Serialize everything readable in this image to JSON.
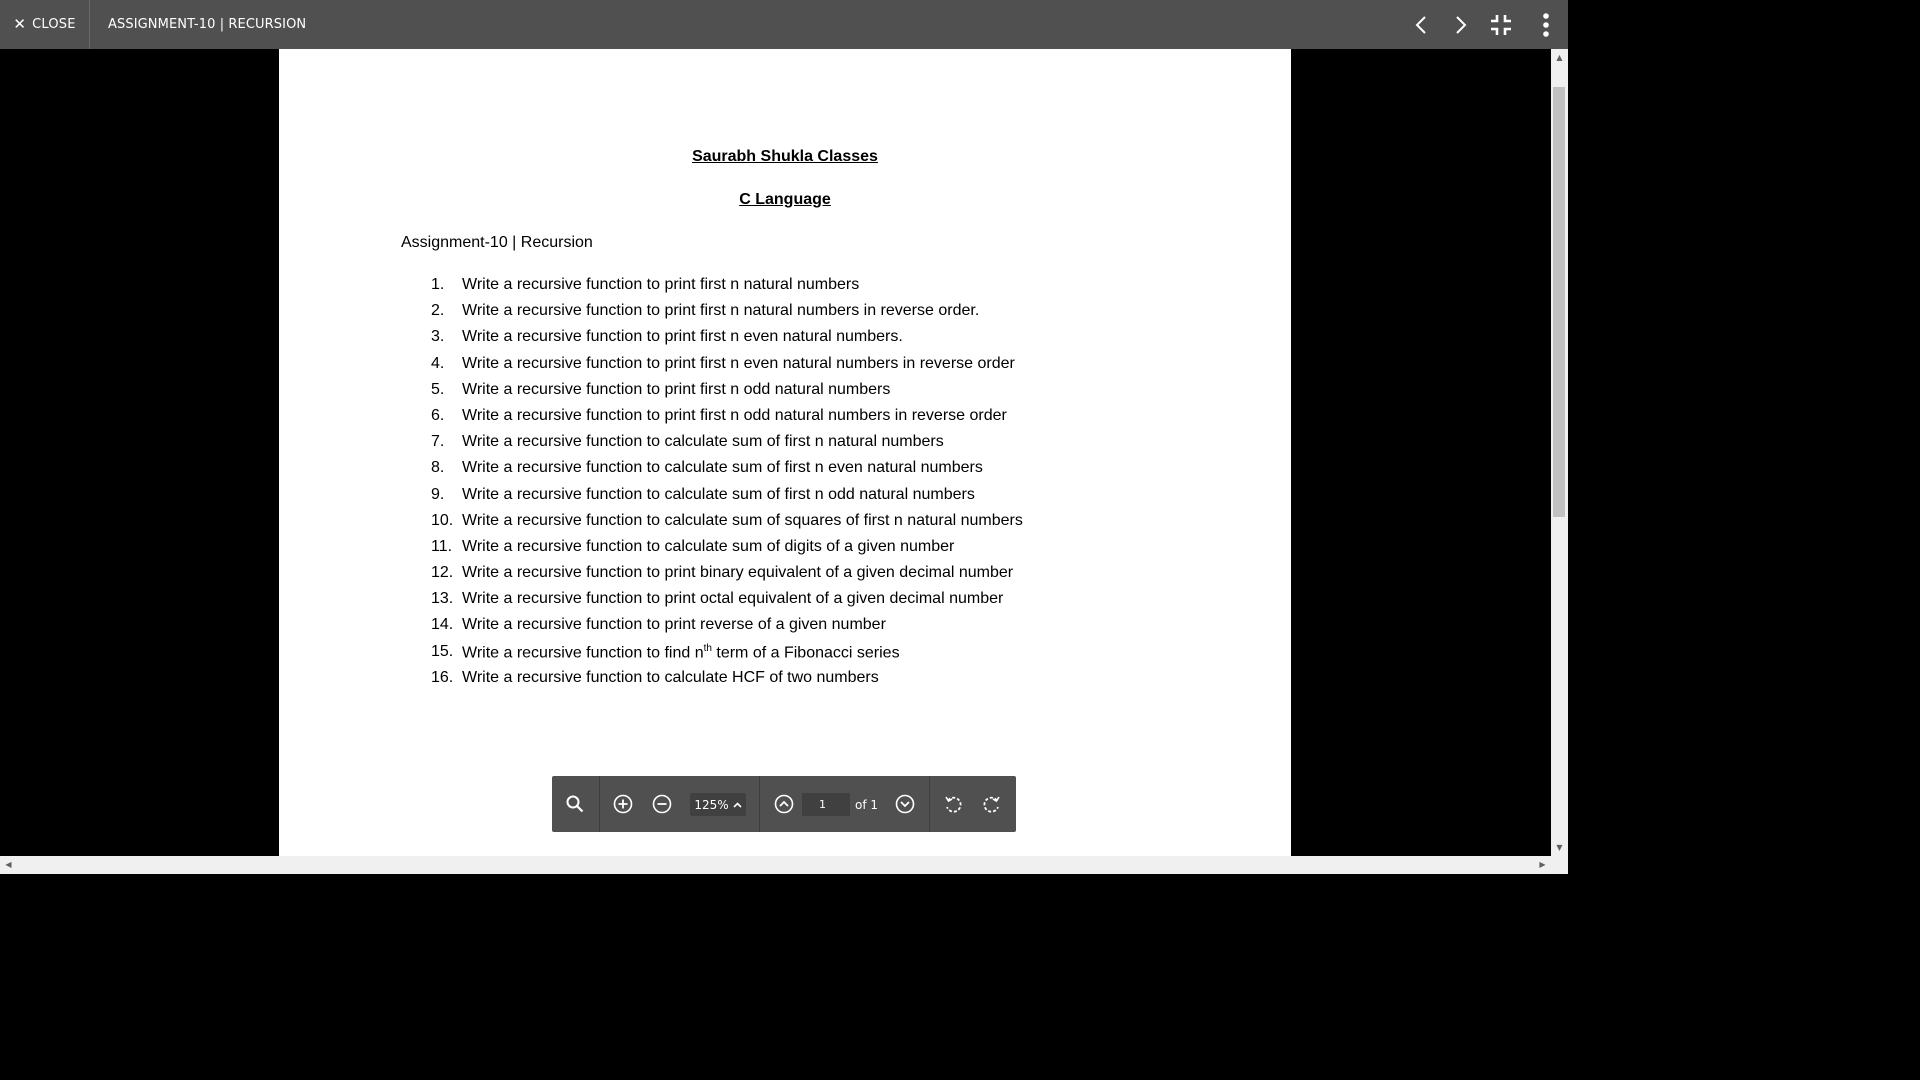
{
  "header": {
    "close_label": "CLOSE",
    "title": "ASSIGNMENT-10 | RECURSION",
    "icons": [
      "close-icon",
      "chevron-left-icon",
      "chevron-right-icon",
      "exit-fullscreen-icon",
      "more-vert-icon"
    ]
  },
  "document": {
    "heading1": "Saurabh Shukla Classes",
    "heading2": "C Language",
    "subtitle": "Assignment-10 | Recursion",
    "questions": [
      {
        "num": "1.",
        "text": "Write a recursive function to print first n natural numbers"
      },
      {
        "num": "2.",
        "text": "Write a recursive function to print first n natural numbers in reverse order."
      },
      {
        "num": "3.",
        "text": "Write a recursive function to print first n even natural numbers."
      },
      {
        "num": "4.",
        "text": "Write a recursive function to print first n even natural numbers in reverse order"
      },
      {
        "num": "5.",
        "text": "Write a recursive function to print first n odd natural numbers"
      },
      {
        "num": "6.",
        "text": "Write a recursive function to print first n odd natural numbers in reverse order"
      },
      {
        "num": "7.",
        "text": "Write a recursive function to calculate sum of first n natural numbers"
      },
      {
        "num": "8.",
        "text": "Write a recursive function to calculate sum of first n even natural numbers"
      },
      {
        "num": "9.",
        "text": "Write a recursive function to calculate sum of first n odd natural numbers"
      },
      {
        "num": "10.",
        "text": "Write a recursive function to calculate sum of squares of first n natural numbers"
      },
      {
        "num": "11.",
        "text": "Write a recursive function to calculate sum of digits of a given number"
      },
      {
        "num": "12.",
        "text": "Write a recursive function to print binary equivalent of a given decimal number"
      },
      {
        "num": "13.",
        "text": "Write a recursive function to print octal equivalent of a given decimal number"
      },
      {
        "num": "14.",
        "text": "Write a recursive function to print reverse of a given number"
      },
      {
        "num": "15.",
        "text_before": "Write a recursive function to find n",
        "sup": "th",
        "text_after": " term of a Fibonacci series"
      },
      {
        "num": "16.",
        "text": "Write a recursive function to calculate HCF of two numbers"
      }
    ]
  },
  "toolbar": {
    "zoom": "125%",
    "page_value": "1",
    "page_of": "of 1",
    "icons": [
      "search-icon",
      "zoom-in-icon",
      "zoom-out-icon",
      "chevron-up-icon",
      "page-up-icon",
      "page-down-icon",
      "rotate-left-icon",
      "rotate-right-icon"
    ]
  },
  "colors": {
    "topbar": "#505050",
    "toolbar": "#505050",
    "background": "#000000",
    "page": "#ffffff"
  }
}
